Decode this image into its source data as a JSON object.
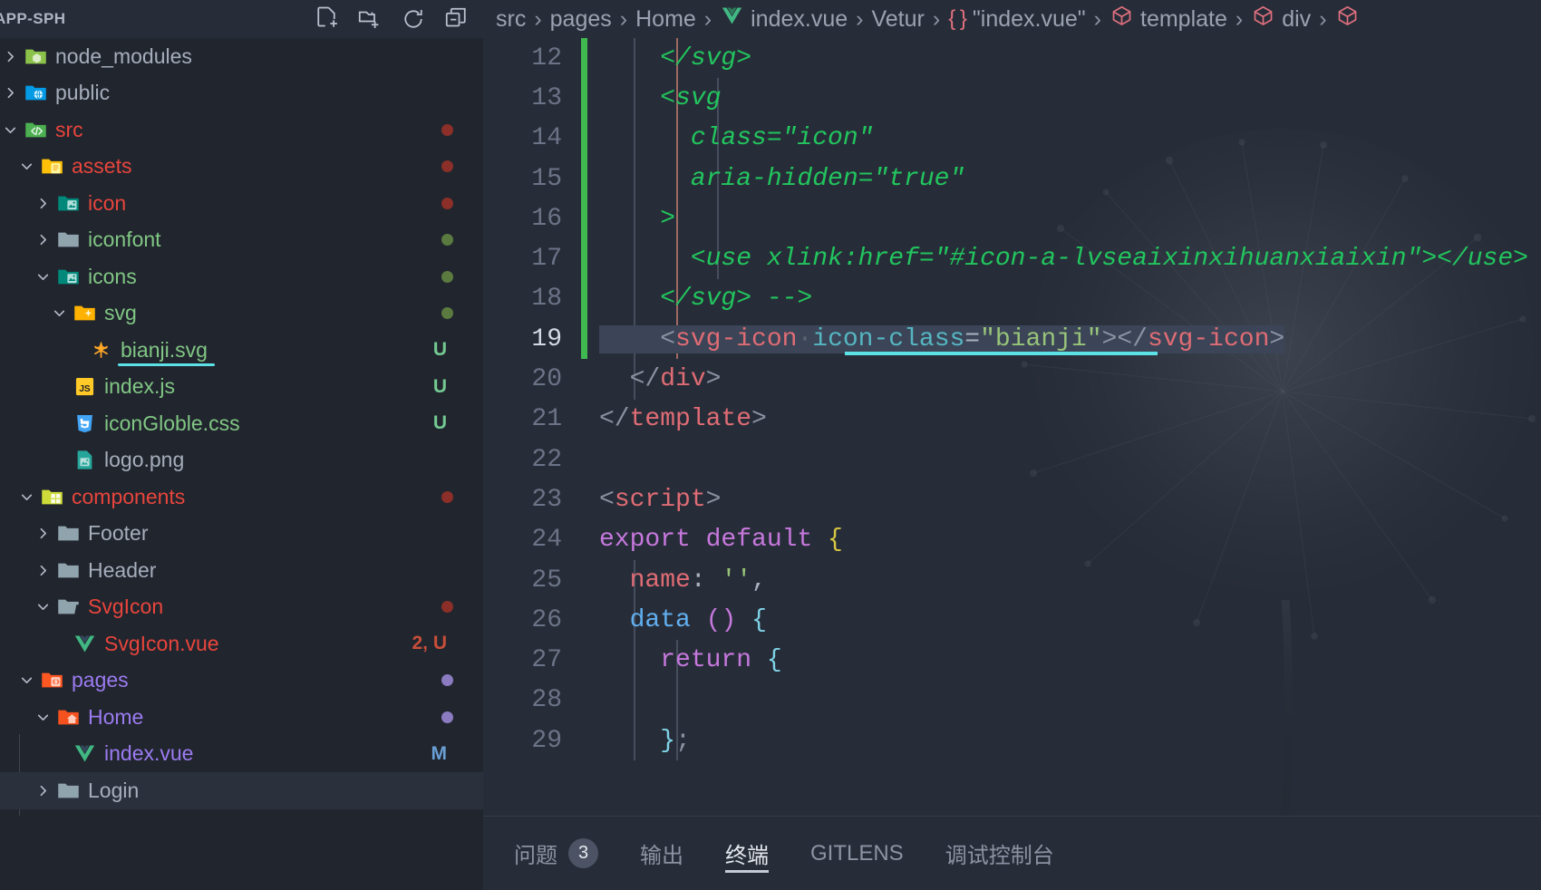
{
  "sidebar": {
    "title": "APP-SPH",
    "actions": [
      {
        "name": "new-file-icon",
        "tooltip": "New File"
      },
      {
        "name": "new-folder-icon",
        "tooltip": "New Folder"
      },
      {
        "name": "refresh-icon",
        "tooltip": "Refresh Explorer"
      },
      {
        "name": "collapse-all-icon",
        "tooltip": "Collapse Folders in Explorer"
      }
    ],
    "tree": [
      {
        "label": "node_modules",
        "depth": 0,
        "twisty": "collapsed",
        "icon": "folder-node",
        "color": "default",
        "badge": "",
        "dot": ""
      },
      {
        "label": "public",
        "depth": 0,
        "twisty": "collapsed",
        "icon": "folder-public",
        "color": "default",
        "badge": "",
        "dot": ""
      },
      {
        "label": "src",
        "depth": 0,
        "twisty": "expanded",
        "icon": "folder-src",
        "color": "red",
        "badge": "",
        "dot": "red"
      },
      {
        "label": "assets",
        "depth": 1,
        "twisty": "expanded",
        "icon": "folder-assets",
        "color": "red",
        "badge": "",
        "dot": "red"
      },
      {
        "label": "icon",
        "depth": 2,
        "twisty": "collapsed",
        "icon": "folder-images",
        "color": "red",
        "badge": "",
        "dot": "red"
      },
      {
        "label": "iconfont",
        "depth": 2,
        "twisty": "collapsed",
        "icon": "folder-plain",
        "color": "green",
        "badge": "",
        "dot": "green"
      },
      {
        "label": "icons",
        "depth": 2,
        "twisty": "expanded",
        "icon": "folder-images",
        "color": "green",
        "badge": "",
        "dot": "green"
      },
      {
        "label": "svg",
        "depth": 3,
        "twisty": "expanded",
        "icon": "folder-svg",
        "color": "green",
        "badge": "",
        "dot": "green"
      },
      {
        "label": "bianji.svg",
        "depth": 4,
        "twisty": "none",
        "icon": "file-svg",
        "color": "green",
        "badge": "U",
        "badge_color": "green",
        "dot": "",
        "underline": true
      },
      {
        "label": "index.js",
        "depth": 3,
        "twisty": "none",
        "icon": "file-js",
        "color": "green",
        "badge": "U",
        "badge_color": "green",
        "dot": ""
      },
      {
        "label": "iconGloble.css",
        "depth": 3,
        "twisty": "none",
        "icon": "file-css",
        "color": "green",
        "badge": "U",
        "badge_color": "green",
        "dot": ""
      },
      {
        "label": "logo.png",
        "depth": 3,
        "twisty": "none",
        "icon": "file-image",
        "color": "default",
        "badge": "",
        "dot": ""
      },
      {
        "label": "components",
        "depth": 1,
        "twisty": "expanded",
        "icon": "folder-components",
        "color": "red",
        "badge": "",
        "dot": "red"
      },
      {
        "label": "Footer",
        "depth": 2,
        "twisty": "collapsed",
        "icon": "folder-plain",
        "color": "default",
        "badge": "",
        "dot": ""
      },
      {
        "label": "Header",
        "depth": 2,
        "twisty": "collapsed",
        "icon": "folder-plain",
        "color": "default",
        "badge": "",
        "dot": ""
      },
      {
        "label": "SvgIcon",
        "depth": 2,
        "twisty": "expanded",
        "icon": "folder-open-plain",
        "color": "red",
        "badge": "",
        "dot": "red"
      },
      {
        "label": "SvgIcon.vue",
        "depth": 3,
        "twisty": "none",
        "icon": "file-vue",
        "color": "red",
        "badge": "2, U",
        "badge_color": "red",
        "dot": ""
      },
      {
        "label": "pages",
        "depth": 1,
        "twisty": "expanded",
        "icon": "folder-pages",
        "color": "purple",
        "badge": "",
        "dot": "purple"
      },
      {
        "label": "Home",
        "depth": 2,
        "twisty": "expanded",
        "icon": "folder-home",
        "color": "purple",
        "badge": "",
        "dot": "purple"
      },
      {
        "label": "index.vue",
        "depth": 3,
        "twisty": "none",
        "icon": "file-vue",
        "color": "purple",
        "badge": "M",
        "badge_color": "blue",
        "dot": ""
      },
      {
        "label": "Login",
        "depth": 2,
        "twisty": "collapsed",
        "icon": "folder-plain",
        "color": "default",
        "badge": "",
        "dot": "",
        "hovered": true
      }
    ]
  },
  "breadcrumb": {
    "items": [
      {
        "label": "src",
        "icon": ""
      },
      {
        "label": "pages",
        "icon": ""
      },
      {
        "label": "Home",
        "icon": ""
      },
      {
        "label": "index.vue",
        "icon": "vue-icon"
      },
      {
        "label": "Vetur",
        "icon": ""
      },
      {
        "label": "\"index.vue\"",
        "icon": "braces-icon"
      },
      {
        "label": "template",
        "icon": "cube-icon"
      },
      {
        "label": "div",
        "icon": "cube-icon"
      },
      {
        "label": "",
        "icon": "cube-icon"
      }
    ],
    "separator": "›"
  },
  "editor": {
    "filename": "index.vue",
    "active_line": 19,
    "lines": [
      {
        "num": "12",
        "indent": 0,
        "tokens": [
          {
            "t": "    </svg>",
            "c": "t-comment"
          }
        ]
      },
      {
        "num": "13",
        "indent": 0,
        "tokens": [
          {
            "t": "    <svg",
            "c": "t-comment"
          }
        ]
      },
      {
        "num": "14",
        "indent": 0,
        "tokens": [
          {
            "t": "      class=\"icon\"",
            "c": "t-comment"
          }
        ]
      },
      {
        "num": "15",
        "indent": 0,
        "tokens": [
          {
            "t": "      aria-hidden=\"true\"",
            "c": "t-comment"
          }
        ]
      },
      {
        "num": "16",
        "indent": 0,
        "tokens": [
          {
            "t": "    >",
            "c": "t-comment"
          }
        ]
      },
      {
        "num": "17",
        "indent": 0,
        "tokens": [
          {
            "t": "      <use xlink:href=\"#icon-a-lvseaixinxihuanxiaixin\"></use>",
            "c": "t-comment"
          }
        ]
      },
      {
        "num": "18",
        "indent": 0,
        "tokens": [
          {
            "t": "    </svg> -->",
            "c": "t-comment"
          }
        ]
      },
      {
        "num": "19",
        "indent": 0,
        "selected": true,
        "tokens": [
          {
            "t": "    ",
            "c": "t-mid"
          },
          {
            "t": "<",
            "c": "t-punct"
          },
          {
            "t": "svg-icon",
            "c": "t-tag"
          },
          {
            "t": "·",
            "c": "dotsep"
          },
          {
            "t": "icon-class",
            "c": "t-attr"
          },
          {
            "t": "=",
            "c": "t-mid"
          },
          {
            "t": "\"bianji\"",
            "c": "t-string"
          },
          {
            "t": ">",
            "c": "t-punct"
          },
          {
            "t": "</",
            "c": "t-punct"
          },
          {
            "t": "svg-icon",
            "c": "t-tag"
          },
          {
            "t": ">",
            "c": "t-punct"
          }
        ]
      },
      {
        "num": "20",
        "indent": 0,
        "tokens": [
          {
            "t": "  ",
            "c": "t-mid"
          },
          {
            "t": "</",
            "c": "t-punct"
          },
          {
            "t": "div",
            "c": "t-tag"
          },
          {
            "t": ">",
            "c": "t-punct"
          }
        ]
      },
      {
        "num": "21",
        "indent": 0,
        "tokens": [
          {
            "t": "</",
            "c": "t-punct"
          },
          {
            "t": "template",
            "c": "t-tag"
          },
          {
            "t": ">",
            "c": "t-punct"
          }
        ]
      },
      {
        "num": "22",
        "indent": 0,
        "tokens": []
      },
      {
        "num": "23",
        "indent": 0,
        "tokens": [
          {
            "t": "<",
            "c": "t-punct"
          },
          {
            "t": "script",
            "c": "t-tag"
          },
          {
            "t": ">",
            "c": "t-punct"
          }
        ]
      },
      {
        "num": "24",
        "indent": 0,
        "tokens": [
          {
            "t": "export default ",
            "c": "t-kw"
          },
          {
            "t": "{",
            "c": "t-br-y"
          }
        ]
      },
      {
        "num": "25",
        "indent": 0,
        "tokens": [
          {
            "t": "  ",
            "c": "t-mid"
          },
          {
            "t": "name",
            "c": "t-prop"
          },
          {
            "t": ": ",
            "c": "t-mid"
          },
          {
            "t": "''",
            "c": "t-str-lt"
          },
          {
            "t": ",",
            "c": "t-mid"
          }
        ]
      },
      {
        "num": "26",
        "indent": 0,
        "tokens": [
          {
            "t": "  ",
            "c": "t-mid"
          },
          {
            "t": "data",
            "c": "t-fn"
          },
          {
            "t": " ",
            "c": "t-mid"
          },
          {
            "t": "()",
            "c": "t-br-p"
          },
          {
            "t": " ",
            "c": "t-mid"
          },
          {
            "t": "{",
            "c": "t-br-c"
          }
        ]
      },
      {
        "num": "27",
        "indent": 0,
        "tokens": [
          {
            "t": "    ",
            "c": "t-mid"
          },
          {
            "t": "return",
            "c": "t-kw"
          },
          {
            "t": " ",
            "c": "t-mid"
          },
          {
            "t": "{",
            "c": "t-br-c"
          }
        ]
      },
      {
        "num": "28",
        "indent": 0,
        "tokens": []
      },
      {
        "num": "29",
        "indent": 0,
        "tokens": [
          {
            "t": "    ",
            "c": "t-mid"
          },
          {
            "t": "}",
            "c": "t-br-c"
          },
          {
            "t": ";",
            "c": "t-punct"
          }
        ]
      }
    ]
  },
  "panel": {
    "tabs": [
      {
        "label": "问题",
        "badge": "3",
        "active": false
      },
      {
        "label": "输出",
        "badge": "",
        "active": false
      },
      {
        "label": "终端",
        "badge": "",
        "active": true
      },
      {
        "label": "GITLENS",
        "badge": "",
        "active": false
      },
      {
        "label": "调试控制台",
        "badge": "",
        "active": false
      }
    ]
  },
  "colors": {
    "accent_underline": "#5ce1e6",
    "git_added": "#3fb950",
    "selection": "#3b4557",
    "editor_bg": "#272d38",
    "sidebar_bg": "#21252e",
    "modified_red": "#e8453c",
    "untracked_green": "#81c784",
    "staged_purple": "#9b7bf0"
  }
}
